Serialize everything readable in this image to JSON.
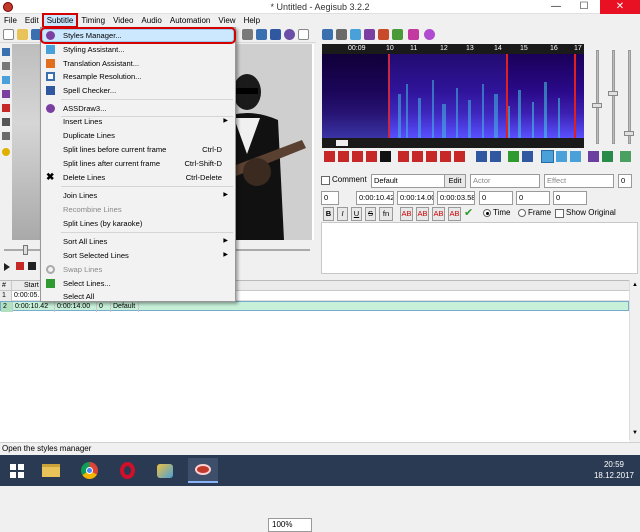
{
  "window": {
    "title": "* Untitled - Aegisub 3.2.2",
    "minimize": "—",
    "maximize": "☐",
    "close": "✕"
  },
  "menu": [
    "File",
    "Edit",
    "Subtitle",
    "Timing",
    "Video",
    "Audio",
    "Automation",
    "View",
    "Help"
  ],
  "subtitle_menu": {
    "items": [
      {
        "label": "Styles Manager...",
        "icon": "styles-manager-icon",
        "highlighted": true
      },
      {
        "label": "Styling Assistant...",
        "icon": "styling-assistant-icon"
      },
      {
        "label": "Translation Assistant...",
        "icon": "translation-assistant-icon"
      },
      {
        "label": "Resample Resolution...",
        "icon": "resample-icon"
      },
      {
        "label": "Spell Checker...",
        "icon": "spell-check-icon"
      },
      {
        "label": "ASSDraw3...",
        "icon": "assdraw-icon"
      },
      {
        "label": "Insert Lines",
        "submenu": true
      },
      {
        "label": "Duplicate Lines"
      },
      {
        "label": "Split lines before current frame",
        "shortcut": "Ctrl-D"
      },
      {
        "label": "Split lines after current frame",
        "shortcut": "Ctrl-Shift-D"
      },
      {
        "label": "Delete Lines",
        "shortcut": "Ctrl-Delete",
        "icon": "delete-icon"
      },
      {
        "label": "Join Lines",
        "submenu": true
      },
      {
        "label": "Recombine Lines",
        "disabled": true
      },
      {
        "label": "Split Lines (by karaoke)"
      },
      {
        "label": "Sort All Lines",
        "submenu": true
      },
      {
        "label": "Sort Selected Lines",
        "submenu": true
      },
      {
        "label": "Swap Lines",
        "disabled": true,
        "icon": "swap-icon"
      },
      {
        "label": "Select Lines...",
        "icon": "select-lines-icon"
      },
      {
        "label": "Select All"
      }
    ]
  },
  "audio": {
    "ruler": [
      "00:09",
      "10",
      "11",
      "12",
      "13",
      "14",
      "15",
      "16",
      "17"
    ]
  },
  "video": {
    "zoom": "100%"
  },
  "edit": {
    "comment_label": "Comment",
    "style": "Default",
    "edit_label": "Edit",
    "actor_placeholder": "Actor",
    "effect_placeholder": "Effect",
    "effect_value": "0",
    "layer": "0",
    "start": "0:00:10.42",
    "end": "0:00:14.00",
    "duration": "0:00:03.58",
    "margin_l": "0",
    "margin_r": "0",
    "margin_v": "0",
    "bold": "B",
    "italic": "I",
    "underline": "U",
    "strike": "S",
    "fn": "fn",
    "ab1": "AB",
    "ab2": "AB",
    "ab3": "AB",
    "ab4": "AB",
    "time_label": "Time",
    "frame_label": "Frame",
    "show_original_label": "Show Original"
  },
  "grid": {
    "header": [
      "#",
      "Start"
    ],
    "rows": [
      {
        "num": "1",
        "start": "0:00:05."
      },
      {
        "num": "2",
        "start": "0:00:10.42",
        "end": "0:00:14.00",
        "layer": "0",
        "style": "Default"
      }
    ]
  },
  "status": "Open the styles manager",
  "clock": {
    "time": "20:59",
    "date": "18.12.2017"
  },
  "colors": {
    "accent_red": "#d40000",
    "highlight": "#cce8ff",
    "taskbar": "#2a3a52"
  }
}
